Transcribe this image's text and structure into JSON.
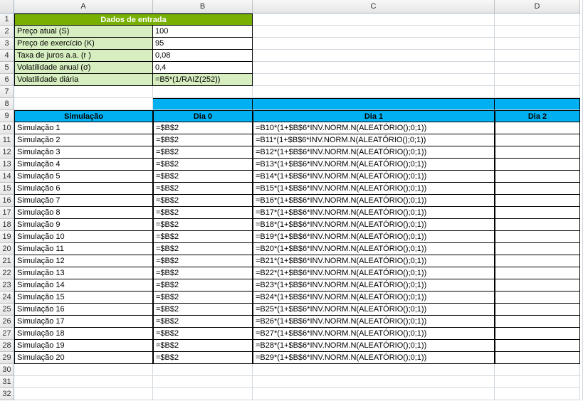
{
  "columns": [
    "A",
    "B",
    "C",
    "D"
  ],
  "rows": [
    "1",
    "2",
    "3",
    "4",
    "5",
    "6",
    "7",
    "8",
    "9",
    "10",
    "11",
    "12",
    "13",
    "14",
    "15",
    "16",
    "17",
    "18",
    "19",
    "20",
    "21",
    "22",
    "23",
    "24",
    "25",
    "26",
    "27",
    "28",
    "29",
    "30",
    "31",
    "32"
  ],
  "dados": {
    "title": "Dados de entrada",
    "rows": [
      {
        "label": "Preço atual (S)",
        "value": "100"
      },
      {
        "label": "Preço de exercício (K)",
        "value": "95"
      },
      {
        "label": "Taxa de juros a.a. (r )",
        "value": "0,08"
      },
      {
        "label": "Volatilidade anual (σ)",
        "value": "0,4"
      },
      {
        "label": "Volatilidade diária",
        "value": "=B5*(1/RAIZ(252))",
        "formula": true
      }
    ]
  },
  "sim": {
    "headers": {
      "a": "Simulação",
      "b": "Dia 0",
      "c": "Dia 1",
      "d": "Dia 2"
    },
    "rows": [
      {
        "a": "Simulação 1",
        "b": "=$B$2",
        "c": "=B10*(1+$B$6*INV.NORM.N(ALEATÓRIO();0;1))"
      },
      {
        "a": "Simulação 2",
        "b": "=$B$2",
        "c": "=B11*(1+$B$6*INV.NORM.N(ALEATÓRIO();0;1))"
      },
      {
        "a": "Simulação 3",
        "b": "=$B$2",
        "c": "=B12*(1+$B$6*INV.NORM.N(ALEATÓRIO();0;1))"
      },
      {
        "a": "Simulação 4",
        "b": "=$B$2",
        "c": "=B13*(1+$B$6*INV.NORM.N(ALEATÓRIO();0;1))"
      },
      {
        "a": "Simulação 5",
        "b": "=$B$2",
        "c": "=B14*(1+$B$6*INV.NORM.N(ALEATÓRIO();0;1))"
      },
      {
        "a": "Simulação 6",
        "b": "=$B$2",
        "c": "=B15*(1+$B$6*INV.NORM.N(ALEATÓRIO();0;1))"
      },
      {
        "a": "Simulação 7",
        "b": "=$B$2",
        "c": "=B16*(1+$B$6*INV.NORM.N(ALEATÓRIO();0;1))"
      },
      {
        "a": "Simulação 8",
        "b": "=$B$2",
        "c": "=B17*(1+$B$6*INV.NORM.N(ALEATÓRIO();0;1))"
      },
      {
        "a": "Simulação 9",
        "b": "=$B$2",
        "c": "=B18*(1+$B$6*INV.NORM.N(ALEATÓRIO();0;1))"
      },
      {
        "a": "Simulação 10",
        "b": "=$B$2",
        "c": "=B19*(1+$B$6*INV.NORM.N(ALEATÓRIO();0;1))"
      },
      {
        "a": "Simulação 11",
        "b": "=$B$2",
        "c": "=B20*(1+$B$6*INV.NORM.N(ALEATÓRIO();0;1))"
      },
      {
        "a": "Simulação 12",
        "b": "=$B$2",
        "c": "=B21*(1+$B$6*INV.NORM.N(ALEATÓRIO();0;1))"
      },
      {
        "a": "Simulação 13",
        "b": "=$B$2",
        "c": "=B22*(1+$B$6*INV.NORM.N(ALEATÓRIO();0;1))"
      },
      {
        "a": "Simulação 14",
        "b": "=$B$2",
        "c": "=B23*(1+$B$6*INV.NORM.N(ALEATÓRIO();0;1))"
      },
      {
        "a": "Simulação 15",
        "b": "=$B$2",
        "c": "=B24*(1+$B$6*INV.NORM.N(ALEATÓRIO();0;1))"
      },
      {
        "a": "Simulação 16",
        "b": "=$B$2",
        "c": "=B25*(1+$B$6*INV.NORM.N(ALEATÓRIO();0;1))"
      },
      {
        "a": "Simulação 17",
        "b": "=$B$2",
        "c": "=B26*(1+$B$6*INV.NORM.N(ALEATÓRIO();0;1))"
      },
      {
        "a": "Simulação 18",
        "b": "=$B$2",
        "c": "=B27*(1+$B$6*INV.NORM.N(ALEATÓRIO();0;1))"
      },
      {
        "a": "Simulação 19",
        "b": "=$B$2",
        "c": "=B28*(1+$B$6*INV.NORM.N(ALEATÓRIO();0;1))"
      },
      {
        "a": "Simulação 20",
        "b": "=$B$2",
        "c": "=B29*(1+$B$6*INV.NORM.N(ALEATÓRIO();0;1))"
      }
    ]
  }
}
